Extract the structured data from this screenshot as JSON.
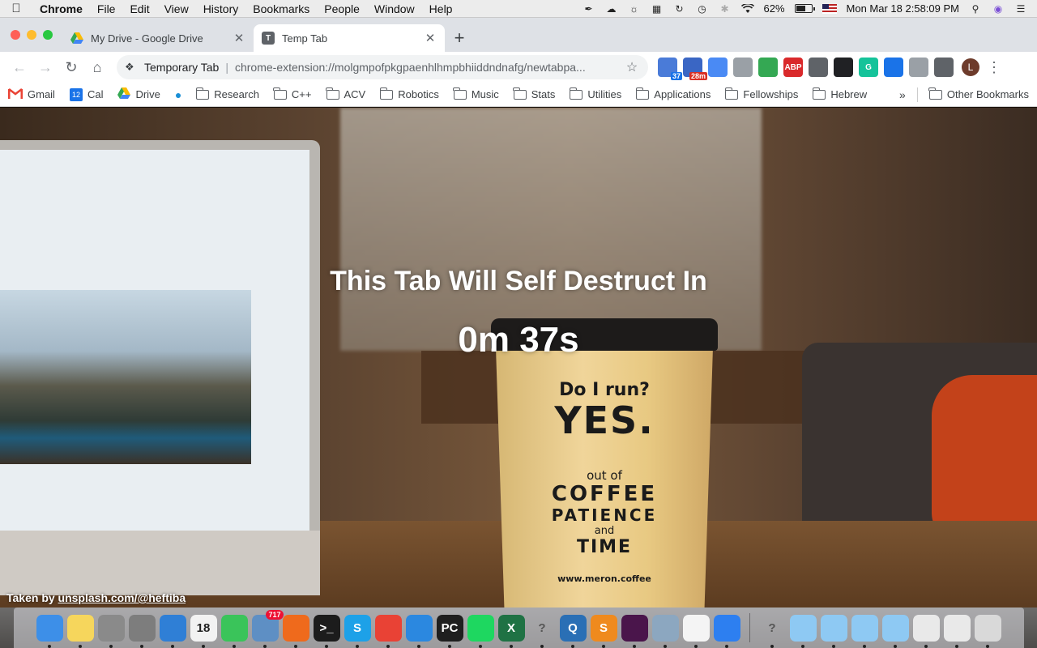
{
  "menubar": {
    "app_name": "Chrome",
    "menus": [
      "File",
      "Edit",
      "View",
      "History",
      "Bookmarks",
      "People",
      "Window",
      "Help"
    ],
    "battery_percent": "62%",
    "battery_level": 0.62,
    "datetime": "Mon Mar 18  2:58:09 PM",
    "status_icons": [
      "eyedropper-icon",
      "creative-cloud-icon",
      "brightness-icon",
      "spaces-icon",
      "sync-icon",
      "time-machine-icon",
      "bluetooth-icon",
      "wifi-icon"
    ]
  },
  "tabs": [
    {
      "title": "My Drive - Google Drive",
      "icon": "google-drive-icon",
      "active": false
    },
    {
      "title": "Temp Tab",
      "icon": "temp-tab-icon",
      "favicon_letter": "T",
      "active": true
    }
  ],
  "toolbar": {
    "site_label": "Temporary Tab",
    "url": "chrome-extension://molgmpofpkgpaenhlhmpbhiiddndnafg/newtabpa...",
    "extensions": [
      {
        "name": "calendar-extension",
        "badge": "37",
        "color": "#4a7bd8"
      },
      {
        "name": "tab-timer-extension",
        "badge": "28m",
        "color": "#3a66c4"
      },
      {
        "name": "translate-extension",
        "color": "#4a8af4"
      },
      {
        "name": "puzzle-extension",
        "color": "#9aa0a6"
      },
      {
        "name": "color-extension",
        "color": "#34a853"
      },
      {
        "name": "adblock-extension",
        "label": "ABP",
        "color": "#d9292b"
      },
      {
        "name": "rocket-extension",
        "color": "#5f6368"
      },
      {
        "name": "clock-extension",
        "color": "#202124"
      },
      {
        "name": "grammarly-extension",
        "label": "G",
        "color": "#15c39a"
      },
      {
        "name": "graduation-extension",
        "color": "#1a73e8"
      },
      {
        "name": "circle-extension",
        "color": "#9aa0a6"
      },
      {
        "name": "bulb-extension",
        "color": "#5f6368"
      }
    ],
    "avatar_letter": "L"
  },
  "bookmarks": {
    "items": [
      {
        "label": "Gmail",
        "icon": "gmail-icon"
      },
      {
        "label": "Cal",
        "icon": "calendar-icon",
        "icon_text": "12"
      },
      {
        "label": "Drive",
        "icon": "google-drive-icon"
      },
      {
        "label": "",
        "icon": "drop-icon"
      },
      {
        "label": "Research",
        "icon": "folder-icon"
      },
      {
        "label": "C++",
        "icon": "folder-icon"
      },
      {
        "label": "ACV",
        "icon": "folder-icon"
      },
      {
        "label": "Robotics",
        "icon": "folder-icon"
      },
      {
        "label": "Music",
        "icon": "folder-icon"
      },
      {
        "label": "Stats",
        "icon": "folder-icon"
      },
      {
        "label": "Utilities",
        "icon": "folder-icon"
      },
      {
        "label": "Applications",
        "icon": "folder-icon"
      },
      {
        "label": "Fellowships",
        "icon": "folder-icon"
      },
      {
        "label": "Hebrew",
        "icon": "folder-icon"
      }
    ],
    "overflow_label": "»",
    "other_label": "Other Bookmarks"
  },
  "page": {
    "heading": "This Tab Will Self Destruct In",
    "countdown": "0m 37s",
    "credit_prefix": "Taken by",
    "credit_link": "unsplash.com/@heftiba"
  },
  "background_photo": {
    "cup_text": [
      "Do I run?",
      "YES.",
      "out of",
      "COFFEE",
      "PATIENCE",
      "and",
      "TIME",
      "www.meron.coffee"
    ]
  },
  "dock": {
    "apps": [
      {
        "name": "finder",
        "color": "#3d8fe8"
      },
      {
        "name": "notes",
        "color": "#f6d65c"
      },
      {
        "name": "disk-utility",
        "color": "#8a8a8a"
      },
      {
        "name": "system-preferences",
        "color": "#7d7d7d"
      },
      {
        "name": "screen-sharing",
        "color": "#2f7fd6"
      },
      {
        "name": "calendar",
        "label": "18",
        "color": "#f2f2f2"
      },
      {
        "name": "facetime",
        "color": "#3ac45a"
      },
      {
        "name": "preview",
        "badge": "717",
        "color": "#5e8fc4"
      },
      {
        "name": "firefox",
        "color": "#ef6a1c"
      },
      {
        "name": "terminal",
        "label": ">_",
        "color": "#1c1c1c"
      },
      {
        "name": "skype",
        "label": "S",
        "color": "#1da1e8"
      },
      {
        "name": "chrome",
        "color": "#e94235"
      },
      {
        "name": "xcode",
        "color": "#2b88e0"
      },
      {
        "name": "pycharm",
        "label": "PC",
        "color": "#1f1f1f"
      },
      {
        "name": "spotify",
        "color": "#1ed760"
      },
      {
        "name": "excel",
        "label": "X",
        "color": "#1f7244"
      },
      {
        "name": "unknown-app",
        "label": "?",
        "color": "transparent"
      },
      {
        "name": "quicktime",
        "label": "Q",
        "color": "#2a6fb5"
      },
      {
        "name": "sublime-text",
        "label": "S",
        "color": "#ef8a1e"
      },
      {
        "name": "slack",
        "color": "#4a154b"
      },
      {
        "name": "image-capture",
        "color": "#8ca7c0"
      },
      {
        "name": "textedit",
        "color": "#f4f4f4"
      },
      {
        "name": "safari",
        "color": "#2d7ff0"
      }
    ],
    "right": [
      {
        "name": "unknown-app",
        "label": "?",
        "color": "transparent"
      },
      {
        "name": "applications-folder",
        "color": "#8ec9f3"
      },
      {
        "name": "downloads-folder",
        "color": "#8ec9f3"
      },
      {
        "name": "documents-folder",
        "color": "#8ec9f3"
      },
      {
        "name": "desktop-folder",
        "color": "#8ec9f3"
      },
      {
        "name": "chrome-window",
        "color": "#e9e9e9"
      },
      {
        "name": "chrome-window",
        "color": "#e9e9e9"
      },
      {
        "name": "trash",
        "color": "#d9d9d9"
      }
    ]
  }
}
